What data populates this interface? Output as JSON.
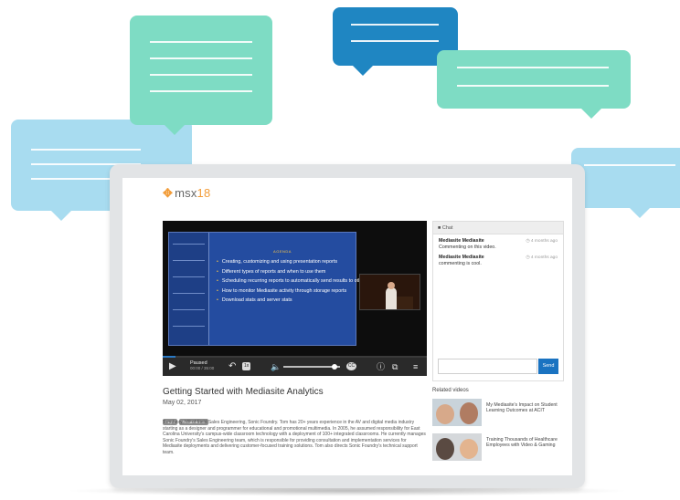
{
  "app": {
    "logo_text": "msx",
    "logo_year": "18"
  },
  "video": {
    "slide_heading": "AGENDA",
    "bullets": [
      "Creating, customizing and using presentation reports",
      "Different types of reports and when to use them",
      "Scheduling recurring reports to automatically send results to others",
      "How to monitor Mediasite activity through storage reports",
      "Download stats and server stats"
    ],
    "brand_mark": "ul",
    "brand_mark_sub": "17",
    "state_label": "Paused",
    "time_label": "00:00 / 35:00",
    "speed_chip": "1x",
    "cc_chip": "CC",
    "progress_fraction": 0.05,
    "volume_fraction": 0.9
  },
  "chat": {
    "header": "Chat",
    "messages": [
      {
        "user": "Mediasite Mediasite",
        "text": "Commenting on this video.",
        "time": "4 months ago"
      },
      {
        "user": "Mediasite Mediasite",
        "text": "commenting is cool.",
        "time": "4 months ago"
      }
    ],
    "input_placeholder": "",
    "send_label": "Send"
  },
  "details": {
    "title": "Getting Started with Mediasite Analytics",
    "date": "May 02, 2017",
    "tags": [
      "Day 1",
      "Fundamentals"
    ],
    "description": "Tom Ivory, VP of Field Sales Engineering, Sonic Foundry. Tom has 20+ years experience in the AV and digital media industry starting as a designer and programmer for educational and promotional multimedia. In 2005, he assumed responsibility for East Carolina University's campus-wide classroom technology with a deployment of 100+ integrated classrooms. He currently manages Sonic Foundry's Sales Engineering team, which is responsible for providing consultation and implementation services for Mediasite deployments and delivering customer-focused training solutions. Tom also directs Sonic Foundry's technical support team."
  },
  "related": {
    "heading": "Related videos",
    "items": [
      {
        "title": "My Mediasite's Impact on Student Learning Outcomes at ACIT"
      },
      {
        "title": "Training Thousands of Healthcare Employees with Video & Gaming"
      }
    ]
  },
  "colors": {
    "bubble_teal": "#7edcc4",
    "bubble_lightblue": "#a8dcf0",
    "bubble_blue": "#1f86c2",
    "bubble_yellow": "#fcd96e",
    "accent": "#1a73c1",
    "logo": "#f29c38"
  }
}
